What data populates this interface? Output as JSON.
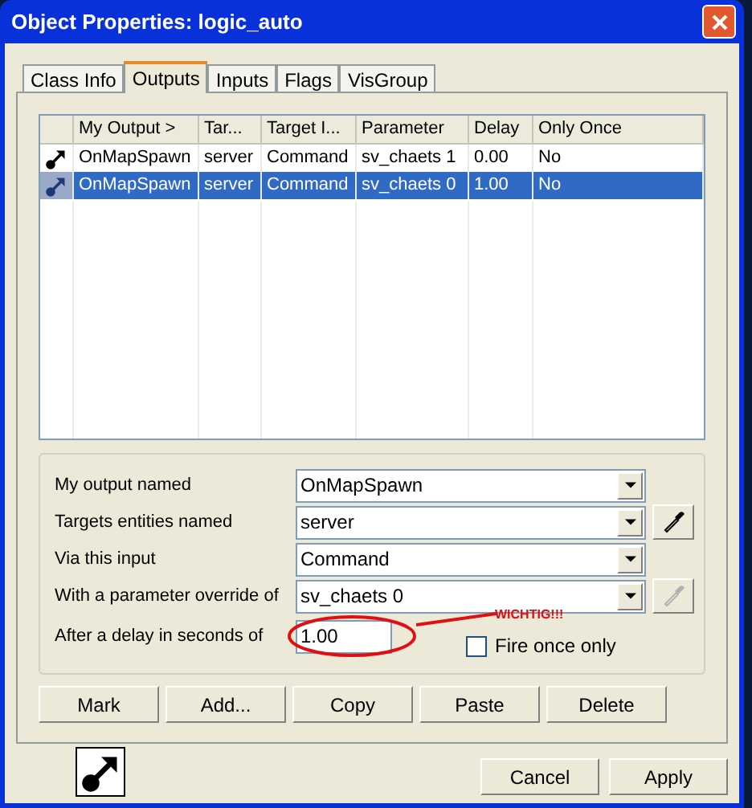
{
  "window": {
    "title": "Object Properties: logic_auto"
  },
  "tabs": [
    {
      "label": "Class Info",
      "selected": false
    },
    {
      "label": "Outputs",
      "selected": true
    },
    {
      "label": "Inputs",
      "selected": false
    },
    {
      "label": "Flags",
      "selected": false
    },
    {
      "label": "VisGroup",
      "selected": false
    }
  ],
  "table": {
    "columns": [
      "My Output  >",
      "Tar...",
      "Target I...",
      "Parameter",
      "Delay",
      "Only Once"
    ],
    "rows": [
      {
        "cells": [
          "OnMapSpawn",
          "server",
          "Command",
          "sv_chaets 1",
          "0.00",
          "No"
        ],
        "selected": false
      },
      {
        "cells": [
          "OnMapSpawn",
          "server",
          "Command",
          "sv_chaets 0",
          "1.00",
          "No"
        ],
        "selected": true
      }
    ]
  },
  "form": {
    "fields": [
      {
        "label": "My output named",
        "value": "OnMapSpawn",
        "kind": "combo"
      },
      {
        "label": "Targets entities named",
        "value": "server",
        "kind": "combo-picker",
        "disabled": false
      },
      {
        "label": "Via this input",
        "value": "Command",
        "kind": "combo"
      },
      {
        "label": "With a parameter override of",
        "value": "sv_chaets 0",
        "kind": "combo-picker",
        "disabled": true
      }
    ],
    "delay": {
      "label": "After a delay in seconds of",
      "value": "1.00"
    },
    "fire_once": {
      "label": "Fire once only",
      "checked": false
    },
    "annotation": {
      "text": "WICHTIG!!!"
    }
  },
  "buttons": [
    "Mark",
    "Add...",
    "Copy",
    "Paste",
    "Delete"
  ],
  "footer_buttons": [
    "Cancel",
    "Apply"
  ]
}
